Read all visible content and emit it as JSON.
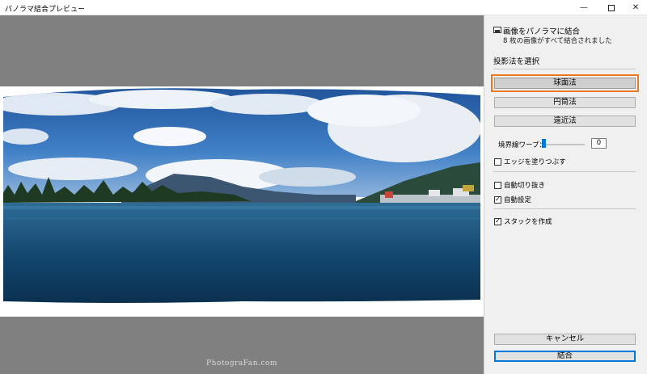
{
  "window": {
    "title": "パノラマ結合プレビュー",
    "min_glyph": "—",
    "close_glyph": "✕"
  },
  "preview": {
    "watermark": "PhotograFan.com"
  },
  "panel": {
    "header_icon": "image-stack-icon",
    "header_title": "画像をパノラマに結合",
    "header_subtitle": "8 枚の画像がすべて結合されました",
    "projection_title": "投影法を選択",
    "projections": [
      {
        "label": "球面法",
        "selected": true
      },
      {
        "label": "円筒法",
        "selected": false
      },
      {
        "label": "遠近法",
        "selected": false
      }
    ],
    "boundary_warp": {
      "label": "境界線ワープ：",
      "value": "0",
      "level": 0
    },
    "checkboxes": {
      "fill_edges": {
        "label": "エッジを塗りつぶす",
        "checked": false
      },
      "auto_crop": {
        "label": "自動切り抜き",
        "checked": false
      },
      "auto_settings": {
        "label": "自動設定",
        "checked": true
      },
      "create_stack": {
        "label": "スタックを作成",
        "checked": true
      }
    },
    "cancel_label": "キャンセル",
    "merge_label": "結合",
    "check_glyph": "✓"
  },
  "colors": {
    "accent": "#0078d7",
    "highlight": "#ea7a24",
    "preview_bg": "#808080"
  }
}
